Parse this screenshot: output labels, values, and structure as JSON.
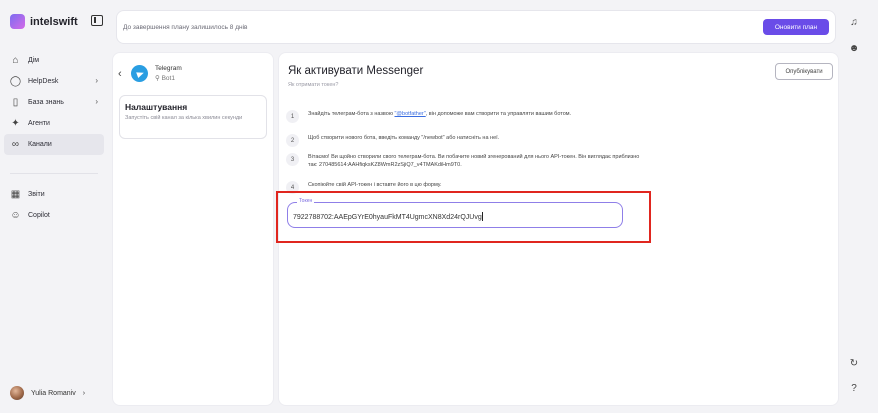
{
  "app": {
    "name": "intelswift"
  },
  "sidebar": {
    "items": [
      {
        "label": "Дім",
        "icon": "home-icon",
        "arrow": false
      },
      {
        "label": "HelpDesk",
        "icon": "headset-icon",
        "arrow": true
      },
      {
        "label": "База знань",
        "icon": "book-icon",
        "arrow": true
      },
      {
        "label": "Агенти",
        "icon": "sparkle-icon",
        "arrow": false
      },
      {
        "label": "Канали",
        "icon": "channels-icon",
        "arrow": false,
        "active": true
      },
      {
        "label": "Звіти",
        "icon": "reports-icon",
        "arrow": false
      },
      {
        "label": "Copilot",
        "icon": "copilot-icon",
        "arrow": false
      }
    ],
    "user": {
      "name": "Yulia Romaniv",
      "arrow": "›"
    }
  },
  "topbar": {
    "plan_text": "До завершення плану залишилось 8 днів",
    "upgrade_label": "Оновити план"
  },
  "channel": {
    "platform": "Telegram",
    "bot_name": "Bot1",
    "settings_title": "Налаштування",
    "settings_desc": "Запустіть свій канал за кілька хвилин секунди"
  },
  "main": {
    "title": "Як активувати Messenger",
    "subtitle": "Як отримати токен?",
    "publish_label": "Опублікувати",
    "steps": [
      {
        "n": "1",
        "before": "Знайдіть телеграм-бота з назвою ",
        "link": "\"@botfather\"",
        "after": ", він допоможе вам створити та управляти вашим ботом."
      },
      {
        "n": "2",
        "text": "Щоб створити нового бота, введіть команду \"/newbot\" або натисніть на неї."
      },
      {
        "n": "3",
        "text": "Вітаємо! Ви щойно створили свого телеграм-бота. Ви побачите новий згенерований для нього API-токен. Він виглядає приблизно так: 270485614:AAHfiqksKZ8WmR2zSjiQ7_v4TMAKdiHm9T0."
      },
      {
        "n": "4",
        "text": "Скопіюйте свій API-токен і вставте його в цю форму."
      }
    ],
    "token_label": "Токен",
    "token_value": "7922788702:AAEpGYrE0hyauFkMT4UgmcXN8Xd24rQJUvg"
  },
  "colors": {
    "accent": "#6a4ce8",
    "telegram": "#2a9ee2",
    "highlight": "#e0261f"
  }
}
